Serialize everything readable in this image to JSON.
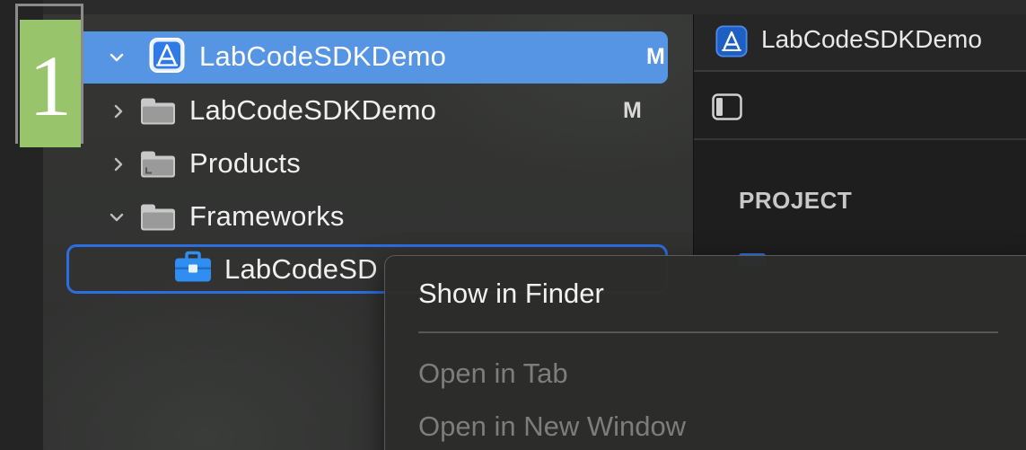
{
  "navigator": {
    "items": [
      {
        "label": "LabCodeSDKDemo",
        "badge": "M",
        "kind": "project",
        "expanded": true,
        "selected": true
      },
      {
        "label": "LabCodeSDKDemo",
        "badge": "M",
        "kind": "folder",
        "expanded": false
      },
      {
        "label": "Products",
        "badge": "",
        "kind": "folder",
        "expanded": false
      },
      {
        "label": "Frameworks",
        "badge": "",
        "kind": "folder",
        "expanded": true
      },
      {
        "label": "LabCodeSDKDemo.framework",
        "visible_label": "LabCodeSD",
        "badge": "",
        "kind": "framework",
        "focused": true
      }
    ]
  },
  "editor": {
    "tab_title": "LabCodeSDKDemo",
    "section_heading": "PROJECT"
  },
  "context_menu": {
    "items": [
      {
        "label": "Show in Finder",
        "enabled": true
      },
      {
        "label": "Open in Tab",
        "enabled": false
      },
      {
        "label": "Open in New Window",
        "enabled": false
      }
    ]
  },
  "step_marker": {
    "number": "1"
  },
  "colors": {
    "selection": "#5694e4",
    "focus_ring": "#2c6ee0",
    "framework_icon": "#2f8ef0",
    "step_badge": "#98c46c"
  }
}
